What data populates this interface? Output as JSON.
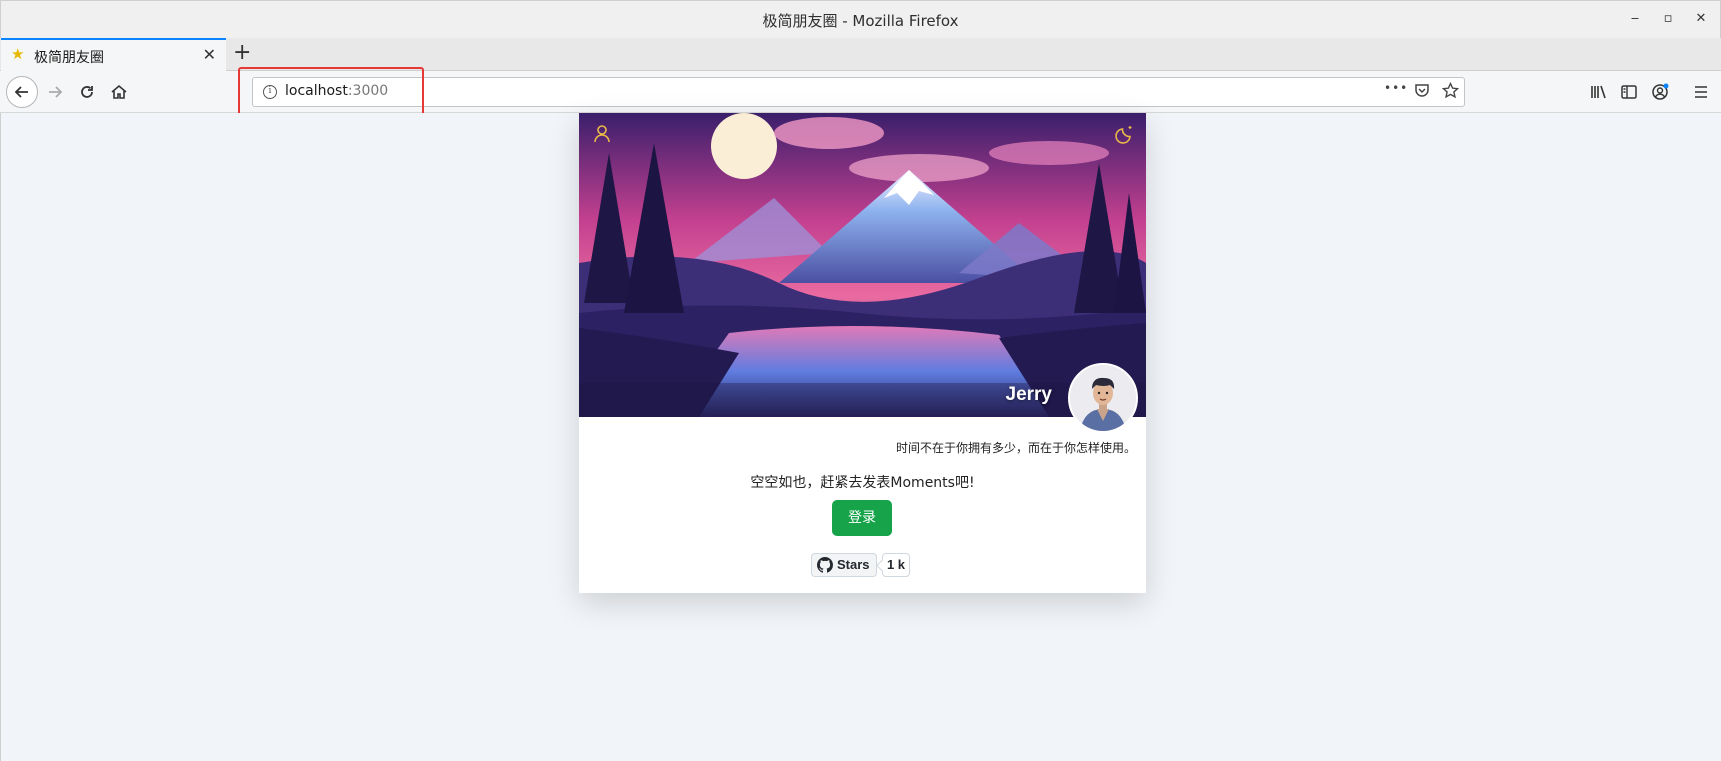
{
  "window": {
    "title": "极简朋友圈 - Mozilla Firefox",
    "minimize": "‒",
    "maximize": "▫",
    "close": "✕"
  },
  "tab": {
    "title": "极简朋友圈",
    "close": "✕",
    "new_tab": "+"
  },
  "urlbar": {
    "host": "localhost",
    "port": ":3000",
    "info": "i",
    "more": "•••"
  },
  "nav_icons": [
    "back-arrow-icon",
    "forward-arrow-icon",
    "reload-icon",
    "home-icon",
    "library-icon",
    "sidebar-icon",
    "account-icon",
    "menu-icon"
  ],
  "profile": {
    "name": "Jerry",
    "motto": "时间不在于你拥有多少，而在于你怎样使用。"
  },
  "main": {
    "empty_message": "空空如也，赶紧去发表Moments吧!",
    "login_label": "登录"
  },
  "github": {
    "stars_label": "Stars",
    "stars_count": "1 k"
  },
  "colors": {
    "accent": "#16a34a",
    "highlight": "#e53935",
    "icon_gold": "#e9b949"
  }
}
